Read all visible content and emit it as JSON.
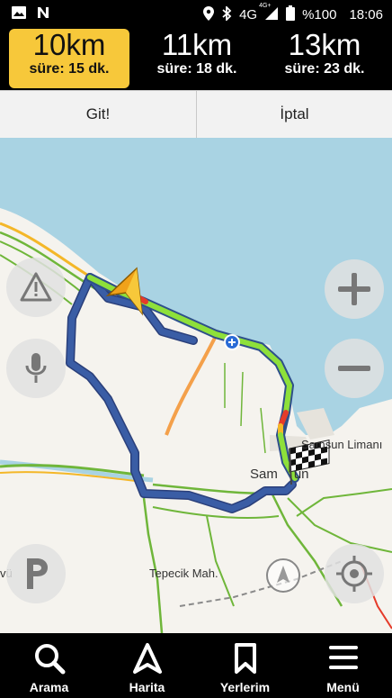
{
  "status_bar": {
    "network": "4G",
    "network_sup": "4G+",
    "battery": "%100",
    "time": "18:06",
    "icons": [
      "image-icon",
      "n-notification-icon",
      "location-icon",
      "bluetooth-icon",
      "signal-icon",
      "battery-icon"
    ]
  },
  "routes": [
    {
      "distance": "10km",
      "duration": "süre: 15 dk.",
      "selected": true
    },
    {
      "distance": "11km",
      "duration": "süre: 18 dk.",
      "selected": false
    },
    {
      "distance": "13km",
      "duration": "süre: 23 dk.",
      "selected": false
    }
  ],
  "actions": {
    "go_label": "Git!",
    "cancel_label": "İptal"
  },
  "map": {
    "labels": {
      "port": "Samsun Limanı",
      "city": "Sam",
      "city_tail": "un",
      "district": "Tepecik Mah.",
      "edge": "vü"
    },
    "controls": [
      "hazard-icon",
      "microphone-icon",
      "zoom-in-icon",
      "zoom-out-icon",
      "parking-icon",
      "compass-icon",
      "locate-icon"
    ],
    "colors": {
      "sea": "#a9d3e3",
      "land": "#f5f3ee",
      "route_alt": "#3a5da5",
      "traffic_free": "#8ee03a",
      "traffic_jam": "#e53b2a",
      "traffic_slow": "#f4b728"
    }
  },
  "bottom_nav": [
    {
      "label": "Arama",
      "icon": "search-icon"
    },
    {
      "label": "Harita",
      "icon": "navigation-arrow-icon"
    },
    {
      "label": "Yerlerim",
      "icon": "bookmark-icon"
    },
    {
      "label": "Menü",
      "icon": "menu-icon"
    }
  ]
}
